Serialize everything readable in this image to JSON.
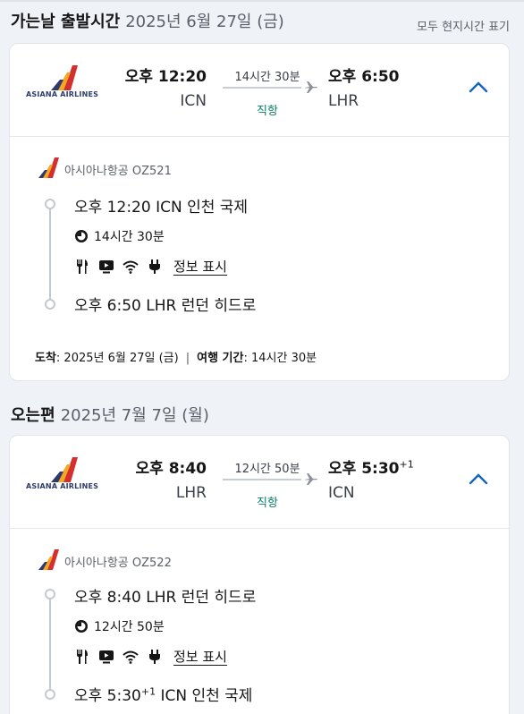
{
  "outbound": {
    "lead": "가는날 출발시간",
    "date": "2025년 6월 27일 (금)",
    "tz_note": "모두 현지시간 표기",
    "summary": {
      "airline_logo_text": "ASIANA AIRLINES",
      "dep_time": "오후 12:20",
      "dep_code": "ICN",
      "duration": "14시간 30분",
      "stops": "직항",
      "arr_time": "오후 6:50",
      "arr_code": "LHR",
      "arr_day_offset": ""
    },
    "detail": {
      "airline_flight": "아시아나항공 OZ521",
      "dep_line": "오후 12:20 ICN 인천 국제",
      "duration": "14시간 30분",
      "info_link": "정보 표시",
      "arr_line_time": "오후 6:50",
      "arr_line_rest": "LHR 런던 히드로",
      "arr_line_offset": "",
      "arrival_label": "도착",
      "arrival_value": ": 2025년 6월 27일 (금)",
      "separator": "|",
      "travel_label": "여행 기간",
      "travel_value": ": 14시간 30분"
    }
  },
  "inbound": {
    "lead": "오는편",
    "date": "2025년 7월 7일 (월)",
    "summary": {
      "airline_logo_text": "ASIANA AIRLINES",
      "dep_time": "오후 8:40",
      "dep_code": "LHR",
      "duration": "12시간 50분",
      "stops": "직항",
      "arr_time": "오후 5:30",
      "arr_code": "ICN",
      "arr_day_offset": "+1"
    },
    "detail": {
      "airline_flight": "아시아나항공 OZ522",
      "dep_line": "오후 8:40 LHR 런던 히드로",
      "duration": "12시간 50분",
      "info_link": "정보 표시",
      "arr_line_time": "오후 5:30",
      "arr_line_offset": "+1",
      "arr_line_rest": "ICN 인천 국제"
    }
  },
  "icons": [
    "plane-icon",
    "chevron-up-icon",
    "clock-icon",
    "meal-icon",
    "entertainment-icon",
    "wifi-icon",
    "power-icon"
  ],
  "colors": {
    "accent": "#1565c0",
    "nonstop": "#0a7d67",
    "airline_red": "#d32f2f",
    "airline_orange": "#f5a623",
    "airline_navy": "#2d3a6b"
  }
}
